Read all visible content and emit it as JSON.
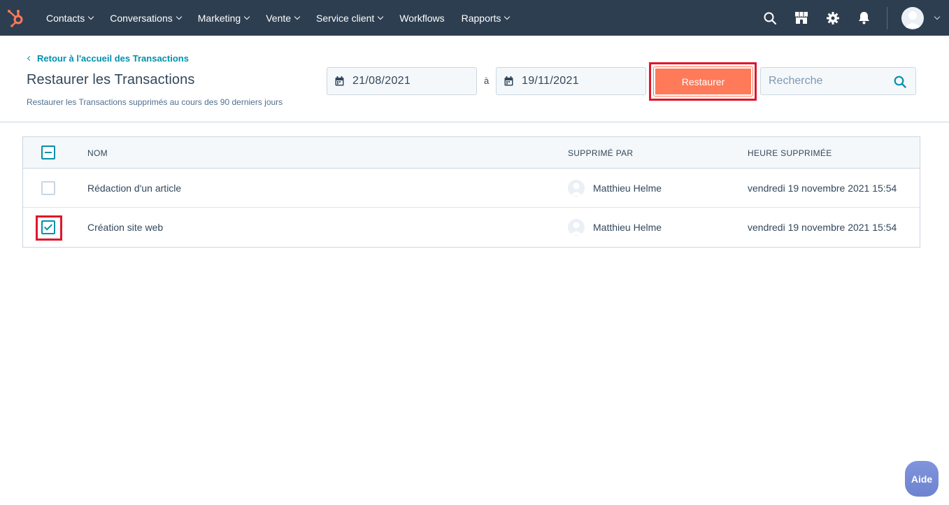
{
  "colors": {
    "nav_bg": "#2d3e50",
    "accent_orange": "#ff7a59",
    "link_teal": "#0091ae",
    "highlight_red": "#e0162b"
  },
  "nav": {
    "items": [
      {
        "label": "Contacts",
        "has_dropdown": true
      },
      {
        "label": "Conversations",
        "has_dropdown": true
      },
      {
        "label": "Marketing",
        "has_dropdown": true
      },
      {
        "label": "Vente",
        "has_dropdown": true
      },
      {
        "label": "Service client",
        "has_dropdown": true
      },
      {
        "label": "Workflows",
        "has_dropdown": false
      },
      {
        "label": "Rapports",
        "has_dropdown": true
      }
    ],
    "icons": [
      "search-icon",
      "marketplace-icon",
      "gear-icon",
      "bell-icon",
      "avatar",
      "chevron-down-icon"
    ]
  },
  "header": {
    "back_link": "Retour à l'accueil des Transactions",
    "title": "Restaurer les Transactions",
    "subtitle": "Restaurer les Transactions supprimés au cours des 90 derniers jours",
    "date_from": "21/08/2021",
    "date_sep": "à",
    "date_to": "19/11/2021",
    "restore_label": "Restaurer",
    "search_placeholder": "Recherche"
  },
  "table": {
    "columns": {
      "name": "NOM",
      "deleted_by": "SUPPRIMÉ PAR",
      "deleted_at": "HEURE SUPPRIMÉE"
    },
    "header_checkbox_state": "indeterminate",
    "rows": [
      {
        "name": "Rédaction d'un article",
        "deleted_by": "Matthieu Helme",
        "deleted_at": "vendredi 19 novembre 2021 15:54",
        "checked": false
      },
      {
        "name": "Création site web",
        "deleted_by": "Matthieu Helme",
        "deleted_at": "vendredi 19 novembre 2021 15:54",
        "checked": true
      }
    ]
  },
  "help": {
    "label": "Aide"
  }
}
